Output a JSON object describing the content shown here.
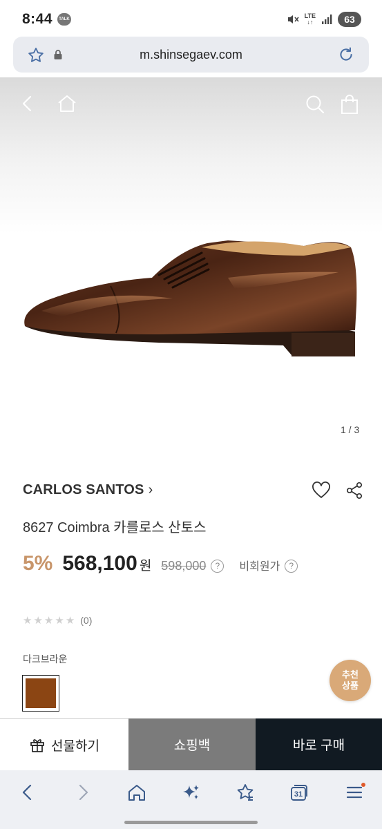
{
  "status_bar": {
    "time": "8:44",
    "talk_badge": "TALK",
    "network_line1": "LTE",
    "network_line2": "↓↑",
    "battery": "63"
  },
  "url_bar": {
    "url": "m.shinsegaev.com"
  },
  "hero": {
    "pager": "1 / 3"
  },
  "product": {
    "brand": "CARLOS SANTOS",
    "brand_chevron": "›",
    "title": "8627 Coimbra 카를로스 산토스",
    "discount": "5%",
    "price": "568,100",
    "currency": "원",
    "original_price": "598,000",
    "help_mark": "?",
    "member_price_label": "비회원가",
    "rating_stars": [
      "★",
      "★",
      "★",
      "★",
      "★"
    ],
    "rating_score": 0,
    "rating_count": "(0)",
    "color_label": "다크브라운",
    "color_swatch": "#8b4513"
  },
  "recommend": {
    "line1": "추천",
    "line2": "상품"
  },
  "buy_bar": {
    "gift_label": "선물하기",
    "bag_label": "쇼핑백",
    "buy_label": "바로 구매"
  },
  "browser_bar": {
    "tabs_count": "31"
  },
  "colors": {
    "accent_discount": "#c8956a",
    "buy_button": "#111a22",
    "bag_button": "#7b7b7b",
    "recommend_badge": "#d9a978"
  }
}
